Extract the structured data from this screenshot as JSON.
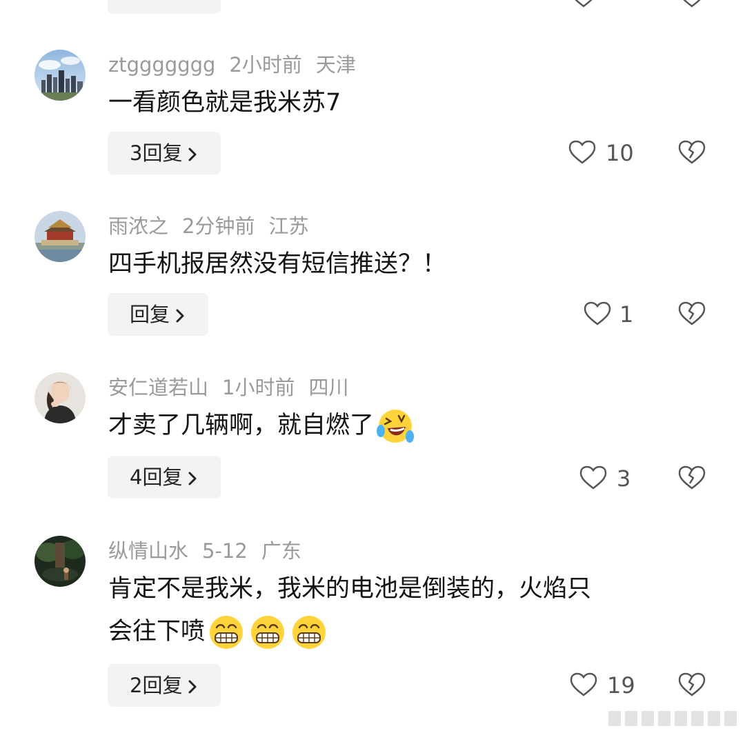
{
  "comments": [
    {
      "username": "ztggggggg",
      "time": "2小时前",
      "location": "天津",
      "text": "一看颜色就是我米苏7",
      "reply_label": "3回复",
      "likes": "10"
    },
    {
      "username": "雨浓之",
      "time": "2分钟前",
      "location": "江苏",
      "text": "四手机报居然没有短信推送？！",
      "reply_label": "回复",
      "likes": "1"
    },
    {
      "username": "安仁道若山",
      "time": "1小时前",
      "location": "四川",
      "text": "才卖了几辆啊，就自燃了",
      "reply_label": "4回复",
      "likes": "3"
    },
    {
      "username": "纵情山水",
      "time": "5-12",
      "location": "广东",
      "text_line1": "肯定不是我米，我米的电池是倒装的，火焰只",
      "text_line2": "会往下喷",
      "reply_label": "2回复",
      "likes": "19"
    }
  ],
  "icons": {
    "heart": "heart-outline-icon",
    "dislike": "broken-heart-icon",
    "chevron": "chevron-right-icon",
    "laugh_emoji": "rolling-laughing-emoji-icon",
    "grin_emoji": "grinning-teeth-emoji-icon"
  },
  "colors": {
    "meta_text": "#9a9a9a",
    "body_text": "#141414",
    "reply_bg": "#f2f3f5",
    "icon_stroke": "#555555"
  }
}
